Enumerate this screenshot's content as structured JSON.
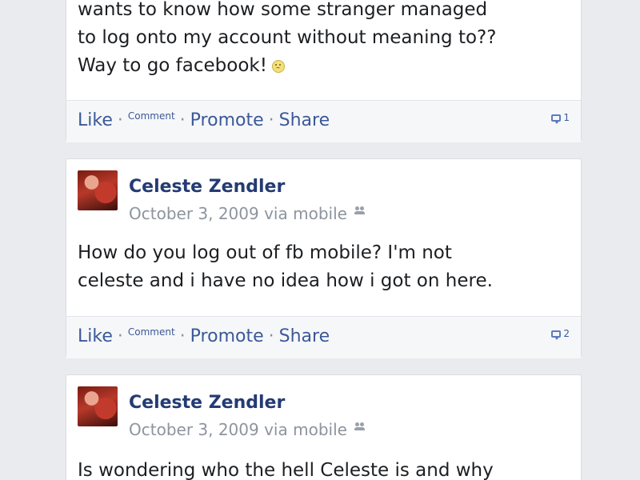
{
  "posts": [
    {
      "body_lines": [
        "wants to know how some stranger managed",
        "to log onto my account without meaning to??",
        "Way to go facebook!"
      ],
      "actions": {
        "like": "Like",
        "separator": "·",
        "comment": "Comment",
        "promote": "Promote",
        "share": "Share"
      },
      "comment_count": "1"
    },
    {
      "author": "Celeste Zendler",
      "date": "October 3, 2009 via mobile",
      "body_lines": [
        "How do you log out of fb mobile? I'm not",
        "celeste and i have no idea how i got on here."
      ],
      "actions": {
        "like": "Like",
        "separator": "·",
        "comment": "Comment",
        "promote": "Promote",
        "share": "Share"
      },
      "comment_count": "2"
    },
    {
      "author": "Celeste Zendler",
      "date": "October 3, 2009 via mobile",
      "body_lines": [
        "Is wondering who the hell Celeste is and why"
      ]
    }
  ],
  "icons": {
    "emoji": "smiley-icon",
    "comment_bubble": "comment-bubble-icon",
    "audience": "friends-icon"
  },
  "colors": {
    "link_blue": "#3b5998",
    "author_blue": "#243b73",
    "meta_gray": "#8d949e",
    "feed_background": "#e9ebee"
  }
}
